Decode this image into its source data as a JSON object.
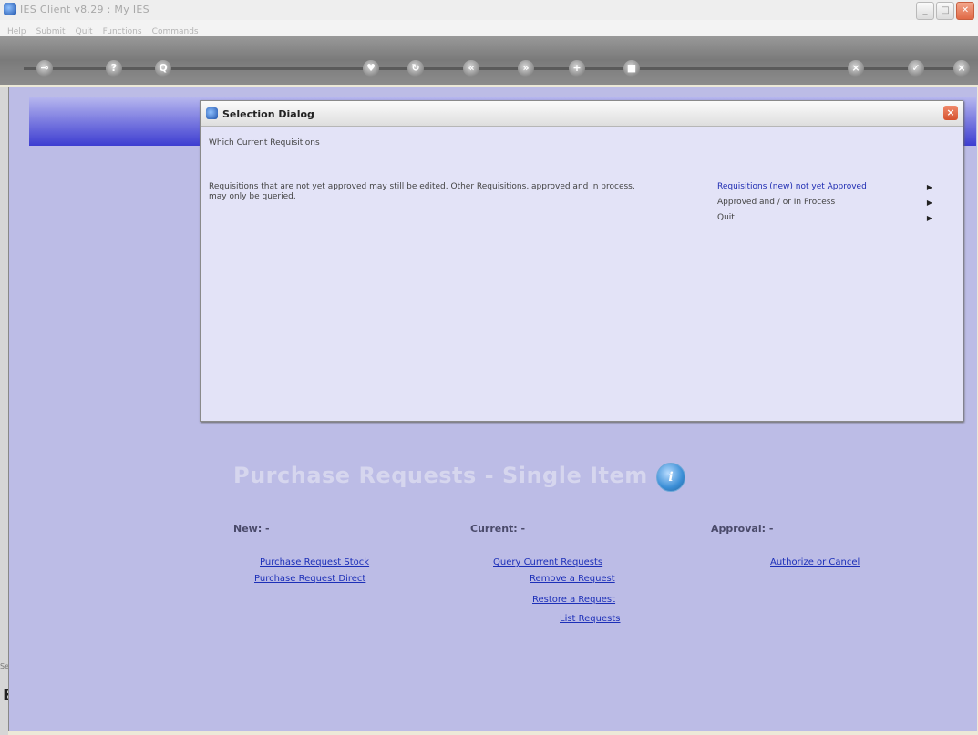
{
  "window": {
    "title": "IES Client v8.29 : My IES",
    "buttons": [
      "_",
      "□",
      "✕"
    ]
  },
  "menubar": {
    "items": [
      "Help",
      "Submit",
      "Quit",
      "Functions",
      "Commands"
    ]
  },
  "toolbar": {
    "buttons": [
      {
        "name": "key-icon",
        "glyph": "⊸"
      },
      {
        "name": "help-icon",
        "glyph": "?"
      },
      {
        "name": "search-icon",
        "glyph": "Q"
      },
      {
        "name": "heart-icon",
        "glyph": "♥"
      },
      {
        "name": "refresh-icon",
        "glyph": "↻"
      },
      {
        "name": "back-icon",
        "glyph": "«"
      },
      {
        "name": "forward-icon",
        "glyph": "»"
      },
      {
        "name": "plus-icon",
        "glyph": "+"
      },
      {
        "name": "stop-icon",
        "glyph": "■"
      },
      {
        "name": "cancel-icon",
        "glyph": "×"
      },
      {
        "name": "check-icon",
        "glyph": "✓"
      },
      {
        "name": "close-icon",
        "glyph": "×"
      }
    ]
  },
  "dialog": {
    "title": "Selection Dialog",
    "subtitle": "Which Current Requisitions",
    "description": "Requisitions that are not yet approved may still be edited. Other Requisitions, approved and in process, may only be queried.",
    "options": [
      {
        "label": "Requisitions (new) not yet Approved",
        "selected": true
      },
      {
        "label": "Approved and / or In Process",
        "selected": false
      },
      {
        "label": "Quit",
        "selected": false
      }
    ]
  },
  "page": {
    "title": "Purchase Requests - Single Item",
    "sections": {
      "new": {
        "heading": "New: -",
        "links": [
          "Purchase Request Stock",
          "Purchase Request Direct"
        ]
      },
      "current": {
        "heading": "Current: -",
        "links": [
          "Query Current Requests",
          "Remove a Request",
          "Restore a Request",
          "List Requests"
        ]
      },
      "approval": {
        "heading": "Approval: -",
        "links": [
          "Authorize or Cancel"
        ]
      }
    }
  },
  "left_strip": {
    "label1": "Sel",
    "label2": "E"
  },
  "colors": {
    "link": "#1c2fb8",
    "client_bg": "#bcbce6",
    "dialog_bg": "#e3e3f7",
    "band_dark": "#3d3dd1"
  }
}
